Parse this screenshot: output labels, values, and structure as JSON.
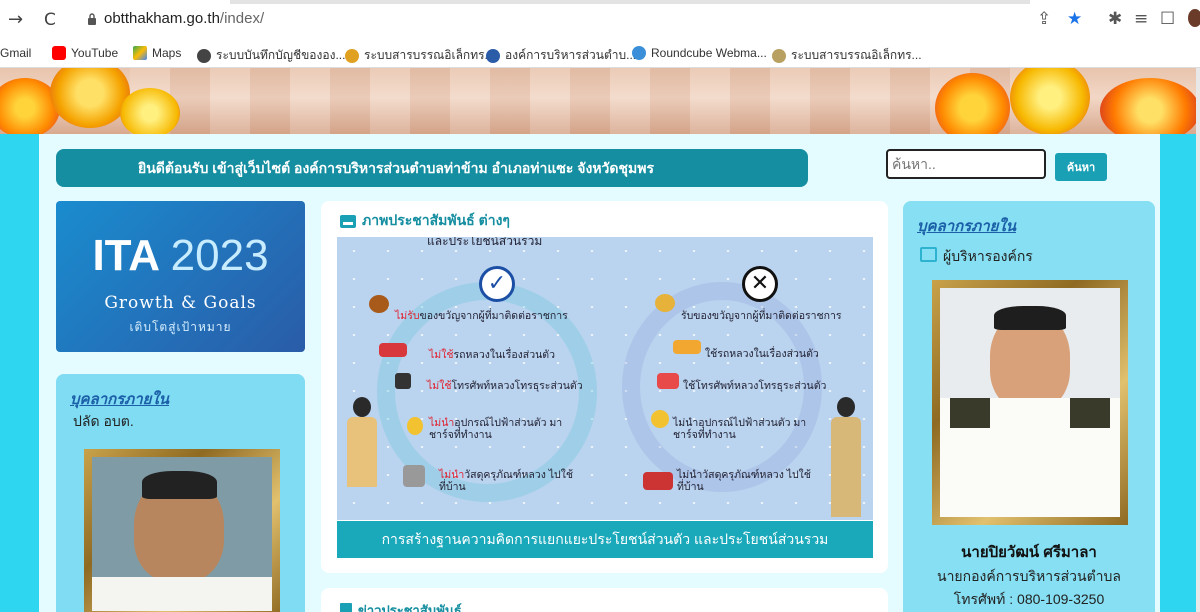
{
  "browser": {
    "url_host": "obtthakham.go.th",
    "url_path": "/index/",
    "bookmarks": [
      {
        "label": "Gmail",
        "icon": "gmail-icon"
      },
      {
        "label": "YouTube",
        "icon": "youtube-icon",
        "color": "#ff0000"
      },
      {
        "label": "Maps",
        "icon": "maps-icon",
        "color": "#34a853"
      },
      {
        "label": "ระบบบันทึกบัญชีขององ...",
        "icon": "globe-icon",
        "color": "#444444"
      },
      {
        "label": "ระบบสารบรรณอิเล็กทร...",
        "icon": "saraban-icon",
        "color": "#e0a020"
      },
      {
        "label": "องค์การบริหารส่วนตำบ...",
        "icon": "org-icon",
        "color": "#2a5ca8"
      },
      {
        "label": "Roundcube Webma...",
        "icon": "roundcube-icon",
        "color": "#3a8fd8"
      },
      {
        "label": "ระบบสารบรรณอิเล็กทร...",
        "icon": "saraban-icon",
        "color": "#b8a060"
      }
    ]
  },
  "header": {
    "welcome": "ยินดีต้อนรับ เข้าสู่เว็บไซต์ องค์การบริหารส่วนตำบลท่าข้าม อำเภอท่าแซะ จังหวัดชุมพร",
    "search_placeholder": "ค้นหา..",
    "search_button": "ค้นหา"
  },
  "ita": {
    "title": "ITA",
    "year": "2023",
    "subtitle": "Growth & Goals",
    "subtitle_th": "เติบโตสู่เป้าหมาย"
  },
  "left_card": {
    "heading": "บุคลากรภายใน",
    "subheading": "ปลัด อบต."
  },
  "center": {
    "heading": "ภาพประชาสัมพันธ์ ต่างๆ",
    "poster_top": "และประโยชน์ส่วนรวม",
    "left_items": [
      {
        "prefix": "ไม่รับ",
        "text": "ของขวัญจากผู้ที่มาติดต่อราชการ"
      },
      {
        "prefix": "ไม่ใช้",
        "text": "รถหลวงในเรื่องส่วนตัว"
      },
      {
        "prefix": "ไม่ใช้",
        "text": "โทรศัพท์หลวงโทรธุระส่วนตัว"
      },
      {
        "prefix": "ไม่นำ",
        "text": "อุปกรณ์ไปฟ้าส่วนตัว มาชาร์จที่ทำงาน"
      },
      {
        "prefix": "ไม่นำ",
        "text": "วัสดุครุภัณฑ์หลวง ไปใช้ที่บ้าน"
      }
    ],
    "right_items": [
      {
        "text": "รับของขวัญจากผู้ที่มาติดต่อราชการ"
      },
      {
        "text": "ใช้รถหลวงในเรื่องส่วนตัว"
      },
      {
        "text": "ใช้โทรศัพท์หลวงโทรธุระส่วนตัว"
      },
      {
        "text": "ไม่นำอุปกรณ์ไปฟ้าส่วนตัว มาชาร์จที่ทำงาน"
      },
      {
        "text": "ไม่นำวัสดุครุภัณฑ์หลวง ไปใช้ที่บ้าน"
      }
    ],
    "caption": "การสร้างฐานความคิดการแยกแยะประโยชน์ส่วนตัว และประโยชน์ส่วนรวม",
    "heading2": "ข่าวประชาสัมพันธ์"
  },
  "right_card": {
    "heading": "บุคลากรภายใน",
    "subheading": "ผู้บริหารองค์กร",
    "name": "นายปิยวัฒน์ ศรีมาลา",
    "position": "นายกองค์การบริหารส่วนตำบล",
    "phone": "โทรศัพท์ : 080-109-3250"
  }
}
